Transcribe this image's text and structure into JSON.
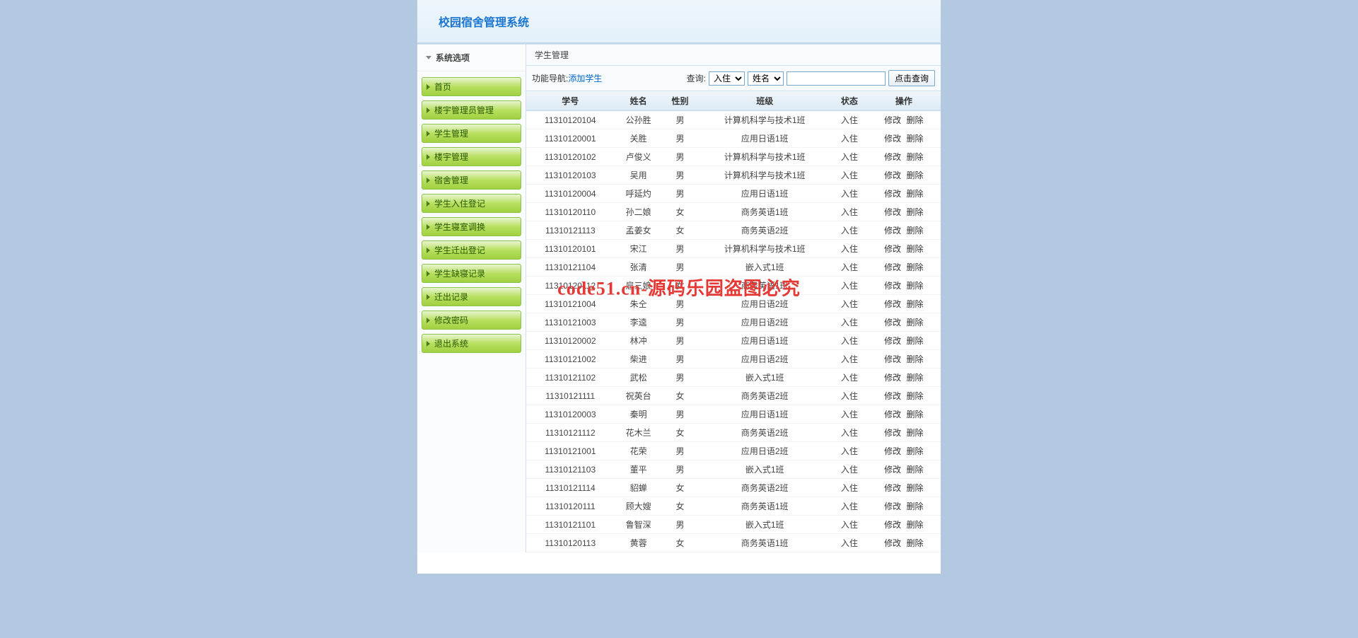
{
  "header": {
    "title": "校园宿舍管理系统"
  },
  "sidebar": {
    "title": "系统选项",
    "items": [
      {
        "label": "首页"
      },
      {
        "label": "楼宇管理员管理"
      },
      {
        "label": "学生管理"
      },
      {
        "label": "楼宇管理"
      },
      {
        "label": "宿舍管理"
      },
      {
        "label": "学生入住登记"
      },
      {
        "label": "学生寝室调换"
      },
      {
        "label": "学生迁出登记"
      },
      {
        "label": "学生缺寝记录"
      },
      {
        "label": "迁出记录"
      },
      {
        "label": "修改密码"
      },
      {
        "label": "退出系统"
      }
    ]
  },
  "main": {
    "panel_title": "学生管理",
    "nav": {
      "label_prefix": "功能导航:",
      "add_link": "添加学生",
      "query_label": "查询:",
      "select1": "入住",
      "select2": "姓名",
      "input_value": "",
      "button": "点击查询"
    },
    "columns": [
      "学号",
      "姓名",
      "性别",
      "班级",
      "状态",
      "操作"
    ],
    "actions": {
      "edit": "修改",
      "delete": "删除"
    },
    "rows": [
      {
        "id": "11310120104",
        "name": "公孙胜",
        "gender": "男",
        "class": "计算机科学与技术1班",
        "status": "入住"
      },
      {
        "id": "11310120001",
        "name": "关胜",
        "gender": "男",
        "class": "应用日语1班",
        "status": "入住"
      },
      {
        "id": "11310120102",
        "name": "卢俊义",
        "gender": "男",
        "class": "计算机科学与技术1班",
        "status": "入住"
      },
      {
        "id": "11310120103",
        "name": "吴用",
        "gender": "男",
        "class": "计算机科学与技术1班",
        "status": "入住"
      },
      {
        "id": "11310120004",
        "name": "呼延灼",
        "gender": "男",
        "class": "应用日语1班",
        "status": "入住"
      },
      {
        "id": "11310120110",
        "name": "孙二娘",
        "gender": "女",
        "class": "商务英语1班",
        "status": "入住"
      },
      {
        "id": "11310121113",
        "name": "孟姜女",
        "gender": "女",
        "class": "商务英语2班",
        "status": "入住"
      },
      {
        "id": "11310120101",
        "name": "宋江",
        "gender": "男",
        "class": "计算机科学与技术1班",
        "status": "入住"
      },
      {
        "id": "11310121104",
        "name": "张清",
        "gender": "男",
        "class": "嵌入式1班",
        "status": "入住"
      },
      {
        "id": "11310120112",
        "name": "扈三娘",
        "gender": "女",
        "class": "商务英语1班",
        "status": "入住"
      },
      {
        "id": "11310121004",
        "name": "朱仝",
        "gender": "男",
        "class": "应用日语2班",
        "status": "入住"
      },
      {
        "id": "11310121003",
        "name": "李逵",
        "gender": "男",
        "class": "应用日语2班",
        "status": "入住"
      },
      {
        "id": "11310120002",
        "name": "林冲",
        "gender": "男",
        "class": "应用日语1班",
        "status": "入住"
      },
      {
        "id": "11310121002",
        "name": "柴进",
        "gender": "男",
        "class": "应用日语2班",
        "status": "入住"
      },
      {
        "id": "11310121102",
        "name": "武松",
        "gender": "男",
        "class": "嵌入式1班",
        "status": "入住"
      },
      {
        "id": "11310121111",
        "name": "祝英台",
        "gender": "女",
        "class": "商务英语2班",
        "status": "入住"
      },
      {
        "id": "11310120003",
        "name": "秦明",
        "gender": "男",
        "class": "应用日语1班",
        "status": "入住"
      },
      {
        "id": "11310121112",
        "name": "花木兰",
        "gender": "女",
        "class": "商务英语2班",
        "status": "入住"
      },
      {
        "id": "11310121001",
        "name": "花荣",
        "gender": "男",
        "class": "应用日语2班",
        "status": "入住"
      },
      {
        "id": "11310121103",
        "name": "董平",
        "gender": "男",
        "class": "嵌入式1班",
        "status": "入住"
      },
      {
        "id": "11310121114",
        "name": "貂蝉",
        "gender": "女",
        "class": "商务英语2班",
        "status": "入住"
      },
      {
        "id": "11310120111",
        "name": "顾大嫂",
        "gender": "女",
        "class": "商务英语1班",
        "status": "入住"
      },
      {
        "id": "11310121101",
        "name": "鲁智深",
        "gender": "男",
        "class": "嵌入式1班",
        "status": "入住"
      },
      {
        "id": "11310120113",
        "name": "黄蓉",
        "gender": "女",
        "class": "商务英语1班",
        "status": "入住"
      }
    ]
  },
  "watermark": "code51.cn-源码乐园盗图必究"
}
